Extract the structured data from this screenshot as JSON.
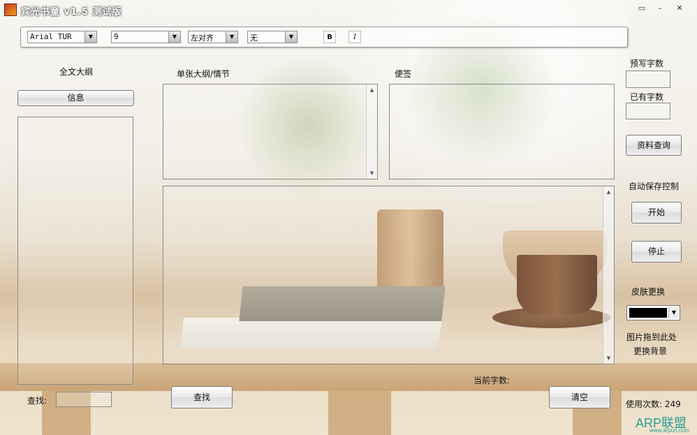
{
  "window": {
    "title": "宾光书童 v1.5 测试版",
    "controls": [
      "▭",
      "–",
      "✕"
    ]
  },
  "toolbar": {
    "font": "Arial TUR",
    "size": "9",
    "align": "左对齐",
    "style": "无",
    "bold_label": "B",
    "italic_label": "I"
  },
  "left": {
    "outline_title": "全文大纲",
    "info_button": "信息",
    "search_label": "查找:"
  },
  "center": {
    "chapter_label": "单张大纲/情节",
    "notes_label": "便签",
    "find_button": "查找",
    "current_count_label": "当前字数:",
    "clear_button": "清空"
  },
  "right": {
    "preset_count_label": "预写字数",
    "existing_count_label": "已有字数",
    "lookup_button": "资料查询",
    "autosave_label": "自动保存控制",
    "start_button": "开始",
    "stop_button": "停止",
    "skin_label": "皮肤更换",
    "skin_color": "#000000",
    "drag_hint_1": "图片拖到此处",
    "drag_hint_2": "更换背景",
    "usage_label": "使用次数:",
    "usage_count": "249"
  },
  "watermark": {
    "logo": "ARP联盟",
    "url": "www.arpun.com"
  }
}
